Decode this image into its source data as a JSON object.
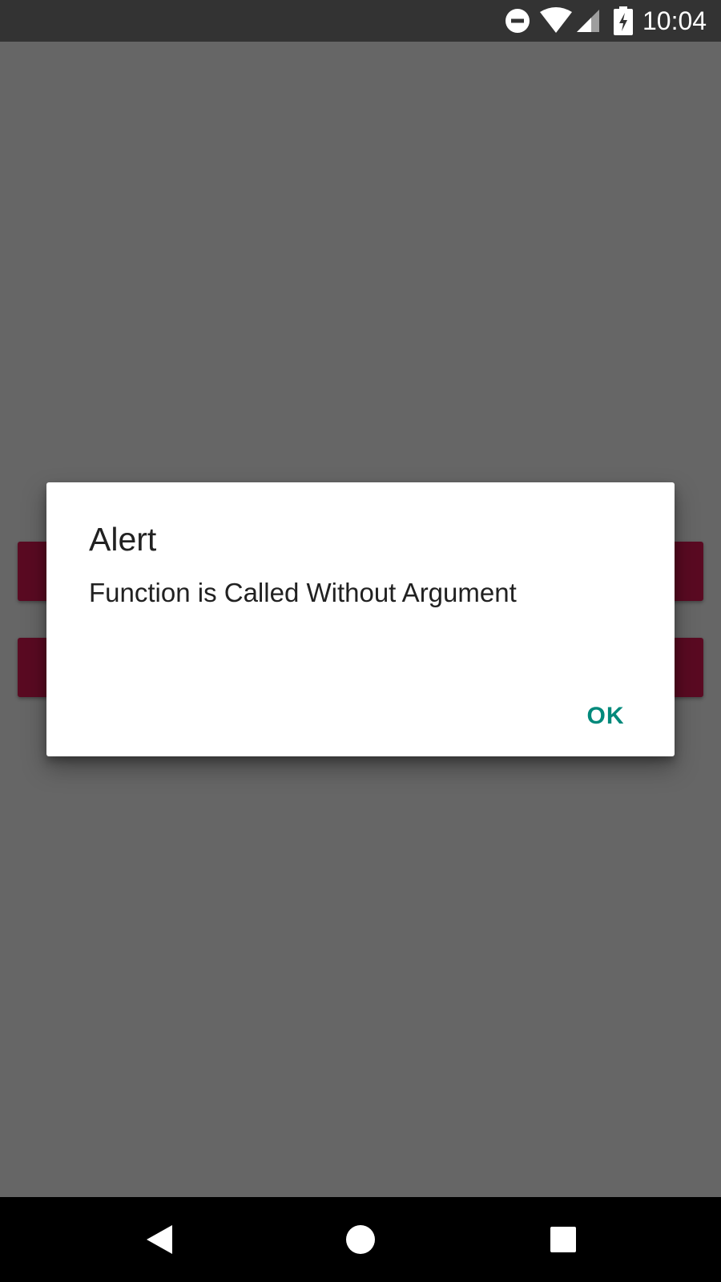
{
  "status_bar": {
    "time": "10:04",
    "icons": [
      "do-not-disturb-icon",
      "wifi-icon",
      "cell-signal-icon",
      "battery-charging-icon"
    ]
  },
  "dialog": {
    "title": "Alert",
    "message": "Function is Called Without Argument",
    "ok_label": "OK",
    "accent_color": "#00897b"
  },
  "background": {
    "scrim_color": "#666666",
    "button_color": "#5a0a22"
  },
  "nav_bar": {
    "icons": [
      "back-icon",
      "home-icon",
      "recents-icon"
    ]
  }
}
